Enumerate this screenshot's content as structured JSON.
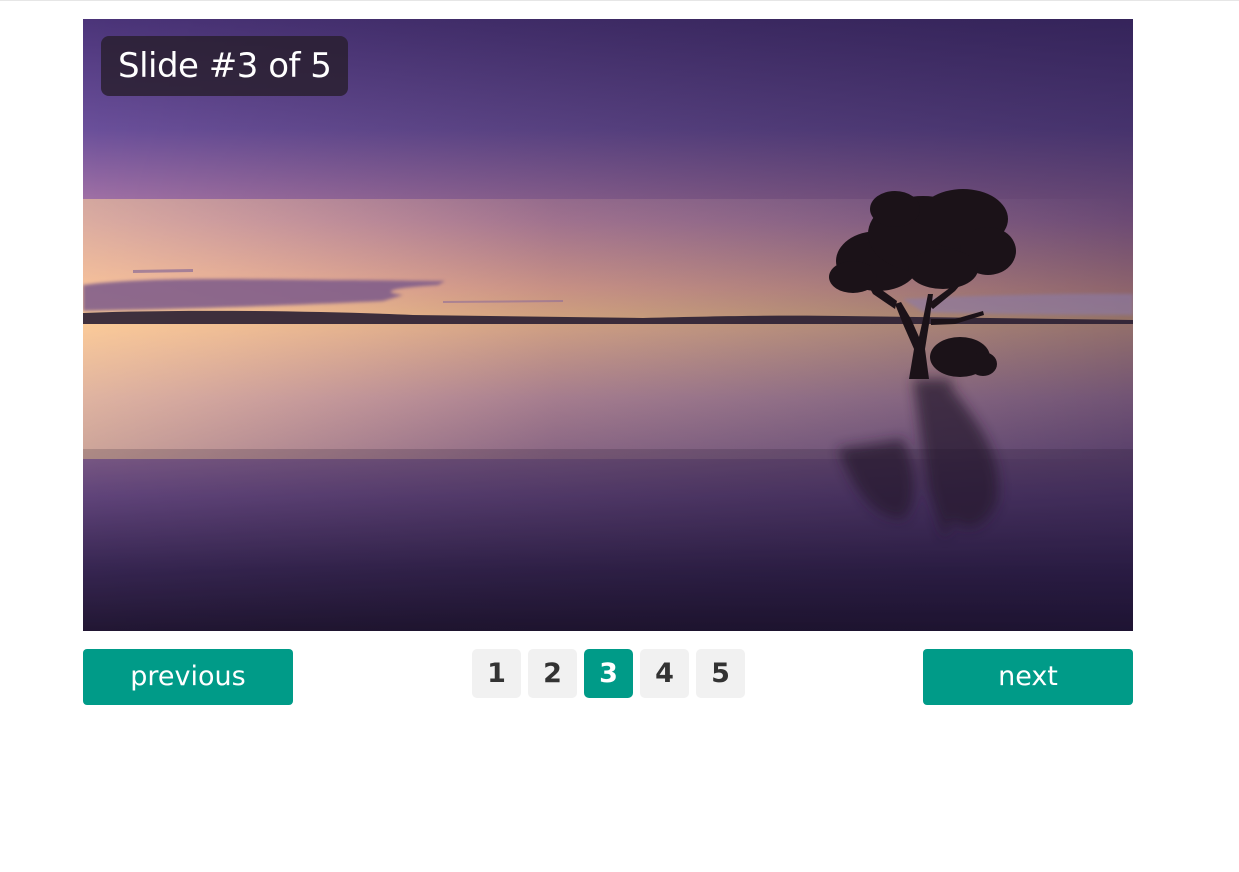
{
  "slideshow": {
    "label": "Slide #3 of 5",
    "current_slide": 3,
    "total_slides": 5,
    "image_alt": "Sunset over a calm lake with a lone tree",
    "previous_label": "previous",
    "next_label": "next",
    "pages": [
      "1",
      "2",
      "3",
      "4",
      "5"
    ],
    "active_page_index": 2
  },
  "colors": {
    "accent": "#009b88",
    "page_inactive_bg": "#f1f1f1",
    "page_inactive_text": "#333333",
    "label_bg": "#2b2030"
  }
}
